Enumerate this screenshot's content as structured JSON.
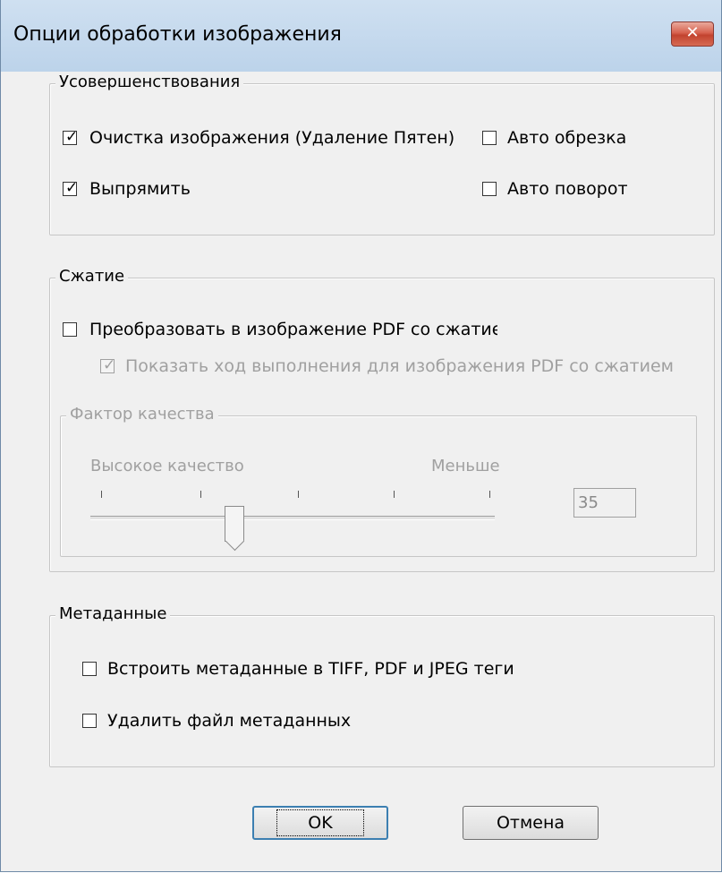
{
  "window": {
    "title": "Опции обработки изображения",
    "close_label": "✕"
  },
  "enhancements": {
    "legend": "Усовершенствования",
    "items": [
      {
        "label": "Очистка изображения (Удаление Пятен)",
        "checked": true
      },
      {
        "label": "Авто обрезка",
        "checked": false
      },
      {
        "label": "Выпрямить",
        "checked": true
      },
      {
        "label": "Авто поворот",
        "checked": false
      }
    ]
  },
  "compression": {
    "legend": "Сжатие",
    "convert_label": "Преобразовать в изображение PDF со сжатием",
    "convert_checked": false,
    "progress_label": "Показать ход выполнения для изображения PDF со сжатием",
    "progress_checked": true,
    "progress_disabled": true,
    "quality": {
      "legend": "Фактор качества",
      "left_label": "Высокое качество",
      "right_label": "Меньше",
      "value": "35",
      "slider_value": 35
    }
  },
  "metadata": {
    "legend": "Метаданные",
    "items": [
      {
        "label": "Встроить метаданные в TIFF, PDF и JPEG теги",
        "checked": false
      },
      {
        "label": "Удалить файл метаданных",
        "checked": false
      }
    ]
  },
  "buttons": {
    "ok": "OK",
    "cancel": "Отмена"
  },
  "colors": {
    "titlebar": "#c4d8ee",
    "close_button": "#c8503b",
    "default_button_border": "#3c7fb1"
  }
}
